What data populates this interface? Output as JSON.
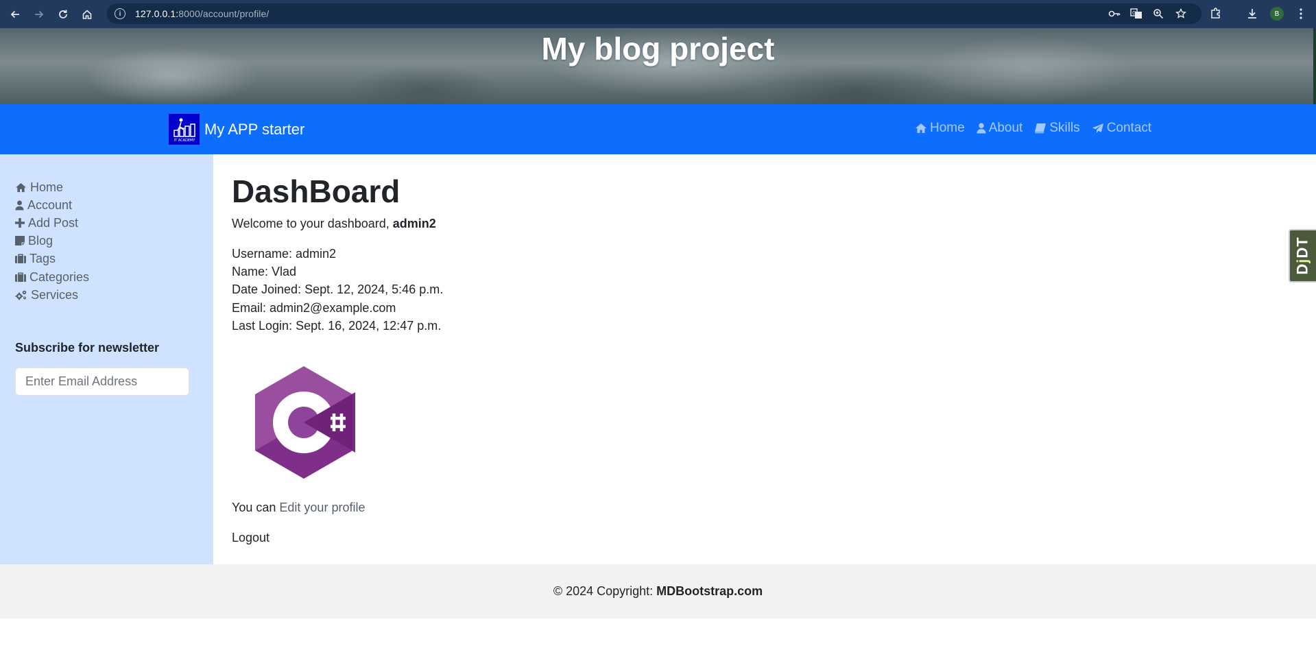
{
  "browser": {
    "url_host": "127.0.0.1:",
    "url_rest": "8000/account/profile/",
    "profile_initial": "B"
  },
  "hero": {
    "title": "My blog project"
  },
  "navbar": {
    "brand": "My APP starter",
    "brand_logo_caption": "IT ACADEMY",
    "links": [
      {
        "label": "Home",
        "icon": "home-icon"
      },
      {
        "label": "About",
        "icon": "user-icon"
      },
      {
        "label": "Skills",
        "icon": "book-icon"
      },
      {
        "label": "Contact",
        "icon": "paper-plane-icon"
      }
    ]
  },
  "sidebar": {
    "items": [
      {
        "label": "Home",
        "icon": "home-icon"
      },
      {
        "label": "Account",
        "icon": "user-icon"
      },
      {
        "label": "Add Post",
        "icon": "plus-icon"
      },
      {
        "label": "Blog",
        "icon": "sticky-note-icon"
      },
      {
        "label": "Tags",
        "icon": "briefcase-icon"
      },
      {
        "label": "Categories",
        "icon": "briefcase-icon"
      },
      {
        "label": "Services",
        "icon": "gears-icon"
      }
    ],
    "newsletter_title": "Subscribe for newsletter",
    "newsletter_placeholder": "Enter Email Address"
  },
  "main": {
    "title": "DashBoard",
    "welcome_prefix": "Welcome to your dashboard, ",
    "welcome_user": "admin2",
    "details": [
      "Username: admin2",
      "Name: Vlad",
      "Date Joined: Sept. 12, 2024, 5:46 p.m.",
      "Email: admin2@example.com",
      "Last Login: Sept. 16, 2024, 12:47 p.m."
    ],
    "image_icon": "csharp-logo-icon",
    "edit_prefix": "You can ",
    "edit_link": "Edit your profile",
    "logout": "Logout"
  },
  "footer": {
    "prefix": "© 2024 Copyright:",
    "brand": "MDBootstrap.com"
  },
  "debug_toolbar": {
    "label_a": "D",
    "label_b": "j",
    "label_c": "DT"
  },
  "colors": {
    "navbar": "#0d6efd",
    "sidebar": "#cfe2ff",
    "footer": "#f2f2f2",
    "chrome": "#223a5e"
  }
}
